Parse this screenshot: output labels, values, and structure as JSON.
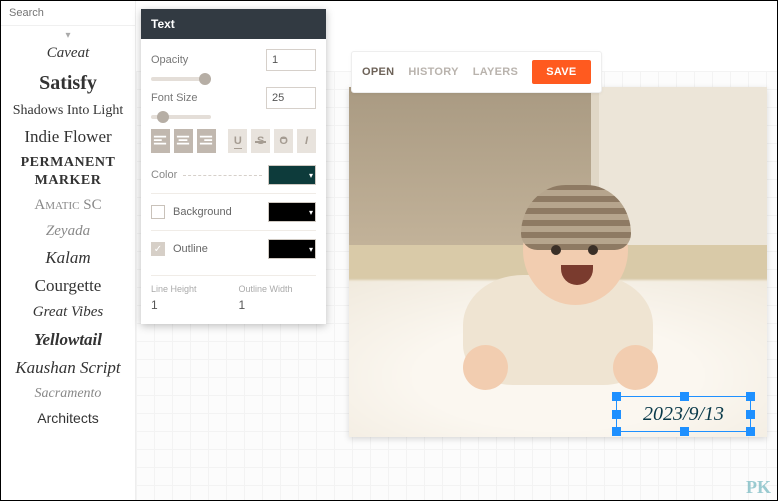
{
  "sidebar": {
    "search_placeholder": "Search",
    "fonts": [
      "Caveat",
      "Satisfy",
      "Shadows Into Light",
      "Indie Flower",
      "Permanent Marker",
      "Amatic SC",
      "Zeyada",
      "Kalam",
      "Courgette",
      "Great Vibes",
      "Yellowtail",
      "Kaushan Script",
      "Sacramento",
      "Architects"
    ]
  },
  "toolbar": {
    "open": "OPEN",
    "history": "HISTORY",
    "layers": "LAYERS",
    "save": "SAVE"
  },
  "text_panel": {
    "title": "Text",
    "opacity_label": "Opacity",
    "opacity_value": "1",
    "fontsize_label": "Font Size",
    "fontsize_value": "25",
    "color_label": "Color",
    "color_value": "#0d3b3b",
    "background_label": "Background",
    "background_checked": false,
    "background_color": "#000000",
    "outline_label": "Outline",
    "outline_checked": true,
    "outline_color": "#000000",
    "line_height_label": "Line Height",
    "line_height_value": "1",
    "outline_width_label": "Outline Width",
    "outline_width_value": "1"
  },
  "canvas": {
    "selected_text": "2023/9/13"
  },
  "watermark": "PK"
}
